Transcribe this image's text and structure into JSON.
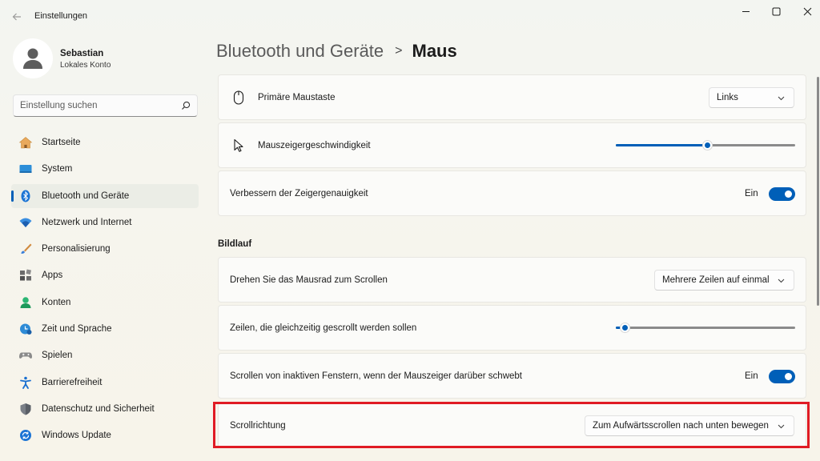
{
  "window": {
    "title": "Einstellungen",
    "back_icon": "back-arrow-icon",
    "controls": [
      "minimize-icon",
      "maximize-icon",
      "close-icon"
    ]
  },
  "profile": {
    "name": "Sebastian",
    "subtitle": "Lokales Konto"
  },
  "search": {
    "placeholder": "Einstellung suchen",
    "icon": "search-icon"
  },
  "sidebar": {
    "items": [
      {
        "label": "Startseite",
        "icon": "home-icon",
        "active": false
      },
      {
        "label": "System",
        "icon": "monitor-icon",
        "active": false
      },
      {
        "label": "Bluetooth und Geräte",
        "icon": "bluetooth-icon",
        "active": true
      },
      {
        "label": "Netzwerk und Internet",
        "icon": "wifi-icon",
        "active": false
      },
      {
        "label": "Personalisierung",
        "icon": "brush-icon",
        "active": false
      },
      {
        "label": "Apps",
        "icon": "apps-icon",
        "active": false
      },
      {
        "label": "Konten",
        "icon": "account-icon",
        "active": false
      },
      {
        "label": "Zeit und Sprache",
        "icon": "clock-globe-icon",
        "active": false
      },
      {
        "label": "Spielen",
        "icon": "gamepad-icon",
        "active": false
      },
      {
        "label": "Barrierefreiheit",
        "icon": "accessibility-icon",
        "active": false
      },
      {
        "label": "Datenschutz und Sicherheit",
        "icon": "shield-icon",
        "active": false
      },
      {
        "label": "Windows Update",
        "icon": "update-icon",
        "active": false
      }
    ]
  },
  "breadcrumb": {
    "parent": "Bluetooth und Geräte",
    "separator": ">",
    "current": "Maus"
  },
  "settings": {
    "primary_button": {
      "label": "Primäre Maustaste",
      "value": "Links"
    },
    "pointer_speed": {
      "label": "Mauszeigergeschwindigkeit",
      "level": 0.51
    },
    "pointer_precision": {
      "label": "Verbessern der Zeigergenauigkeit",
      "state": "Ein",
      "on": true
    },
    "section_scroll": "Bildlauf",
    "wheel_scroll": {
      "label": "Drehen Sie das Mausrad zum Scrollen",
      "value": "Mehrere Zeilen auf einmal"
    },
    "lines_per_scroll": {
      "label": "Zeilen, die gleichzeitig gescrollt werden sollen",
      "level": 0.05
    },
    "inactive_scroll": {
      "label": "Scrollen von inaktiven Fenstern, wenn der Mauszeiger darüber schwebt",
      "state": "Ein",
      "on": true
    },
    "scroll_direction": {
      "label": "Scrollrichtung",
      "value": "Zum Aufwärtsscrollen nach unten bewegen"
    }
  },
  "colors": {
    "accent": "#005fb8",
    "highlight_box": "#e01b24"
  }
}
